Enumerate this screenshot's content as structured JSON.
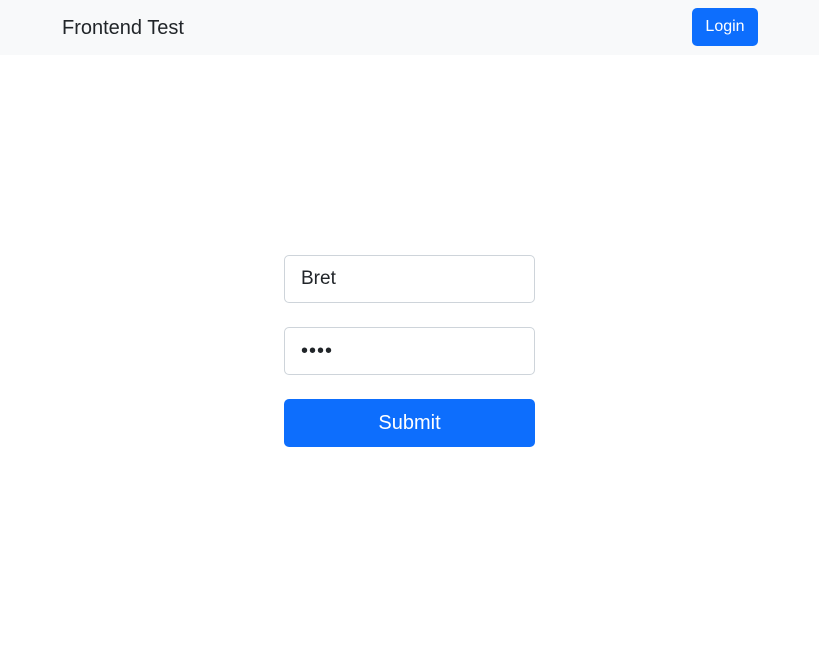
{
  "navbar": {
    "brand": "Frontend Test",
    "login_label": "Login"
  },
  "login_form": {
    "username_value": "Bret",
    "password_value": "••••",
    "submit_label": "Submit"
  },
  "colors": {
    "primary": "#0d6efd",
    "navbar_bg": "#f8f9fa",
    "text": "#212529",
    "input_border": "#ced4da"
  }
}
